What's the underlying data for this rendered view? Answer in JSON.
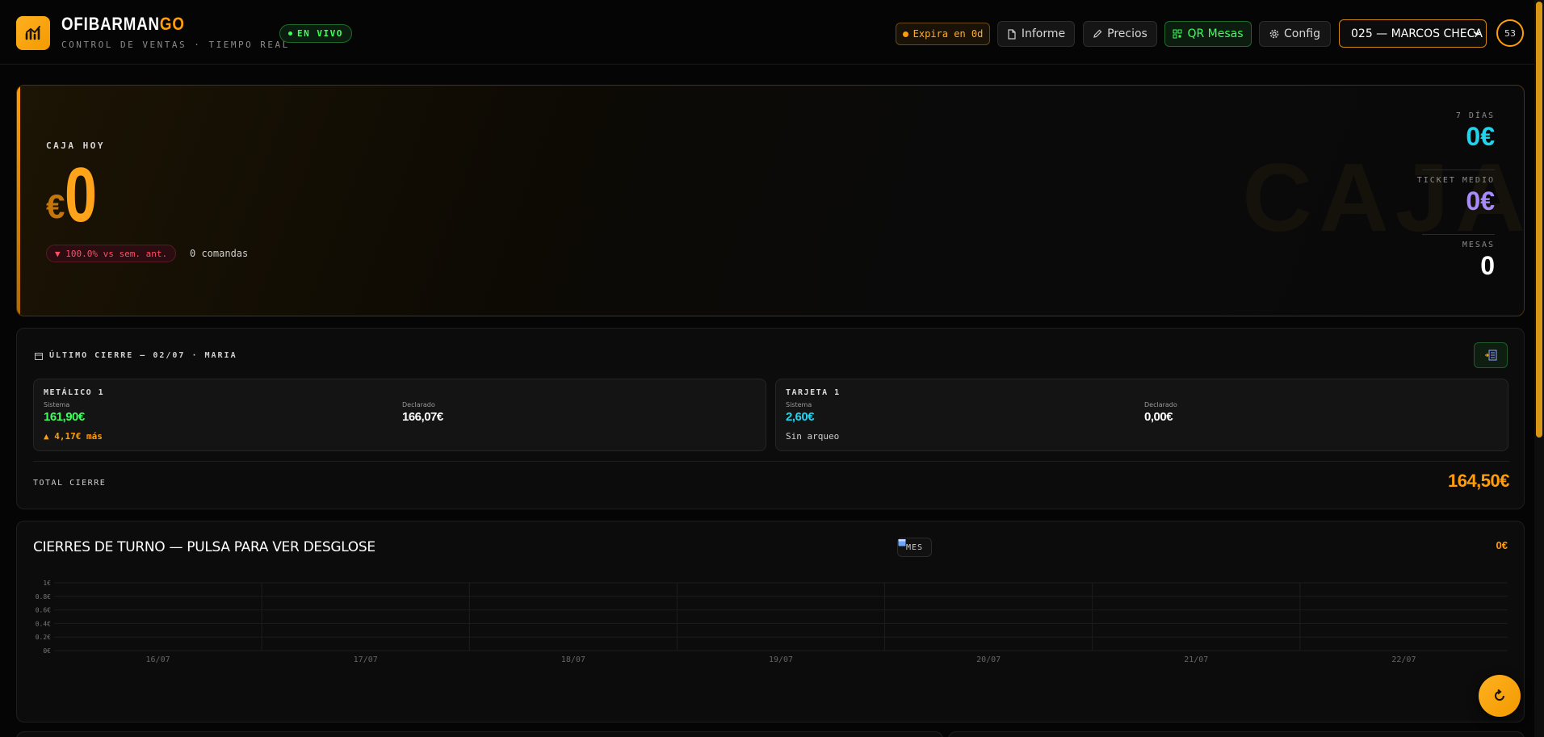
{
  "app": {
    "brand_main": "OFIBARMAN",
    "brand_accent": "GO",
    "subtitle": "CONTROL DE VENTAS · TIEMPO REAL",
    "live_label": "EN VIVO"
  },
  "header": {
    "expira_label": "Expira en 0d",
    "informe_label": "Informe",
    "precios_label": "Precios",
    "qr_label": "QR Mesas",
    "config_label": "Config",
    "local_selected": "025 — MARCOS CHECA (",
    "ring_value": "53"
  },
  "caja": {
    "label": "CAJA HOY",
    "currency": "€",
    "value": "0",
    "delta": "▼ 100.0% vs sem. ant.",
    "comandas": "0 comandas",
    "watermark": "CAJA",
    "stats": [
      {
        "label": "7 DÍAS",
        "value": "0€"
      },
      {
        "label": "TICKET MEDIO",
        "value": "0€"
      },
      {
        "label": "MESAS",
        "value": "0"
      }
    ]
  },
  "cierre": {
    "title": "ÚLTIMO CIERRE — 02/07 · MARIA",
    "metodos": [
      {
        "title": "METÁLICO 1",
        "sistema_label": "Sistema",
        "sistema_value": "161,90€",
        "declarado_label": "Declarado",
        "declarado_value": "166,07€",
        "note": "▲ 4,17€ más"
      },
      {
        "title": "TARJETA 1",
        "sistema_label": "Sistema",
        "sistema_value": "2,60€",
        "declarado_label": "Declarado",
        "declarado_value": "0,00€",
        "note": "Sin arqueo"
      }
    ],
    "total_label": "TOTAL CIERRE",
    "total_value": "164,50€"
  },
  "turnos": {
    "title": "CIERRES DE TURNO — PULSA PARA VER DESGLOSE",
    "period_label": "MES",
    "total": "0€"
  },
  "colors": {
    "accent": "#ff9d0a",
    "green": "#3cff5c",
    "cyan": "#22d3ee",
    "purple": "#a78bfa",
    "red": "#ff4f66"
  },
  "chart_data": {
    "type": "bar",
    "categories": [
      "16/07",
      "17/07",
      "18/07",
      "19/07",
      "20/07",
      "21/07",
      "22/07"
    ],
    "values": [
      0,
      0,
      0,
      0,
      0,
      0,
      0
    ],
    "ylim": [
      0,
      1
    ],
    "yticks": [
      "1€",
      "0.8€",
      "0.6€",
      "0.4€",
      "0.2€",
      "0€"
    ],
    "grid": true
  }
}
